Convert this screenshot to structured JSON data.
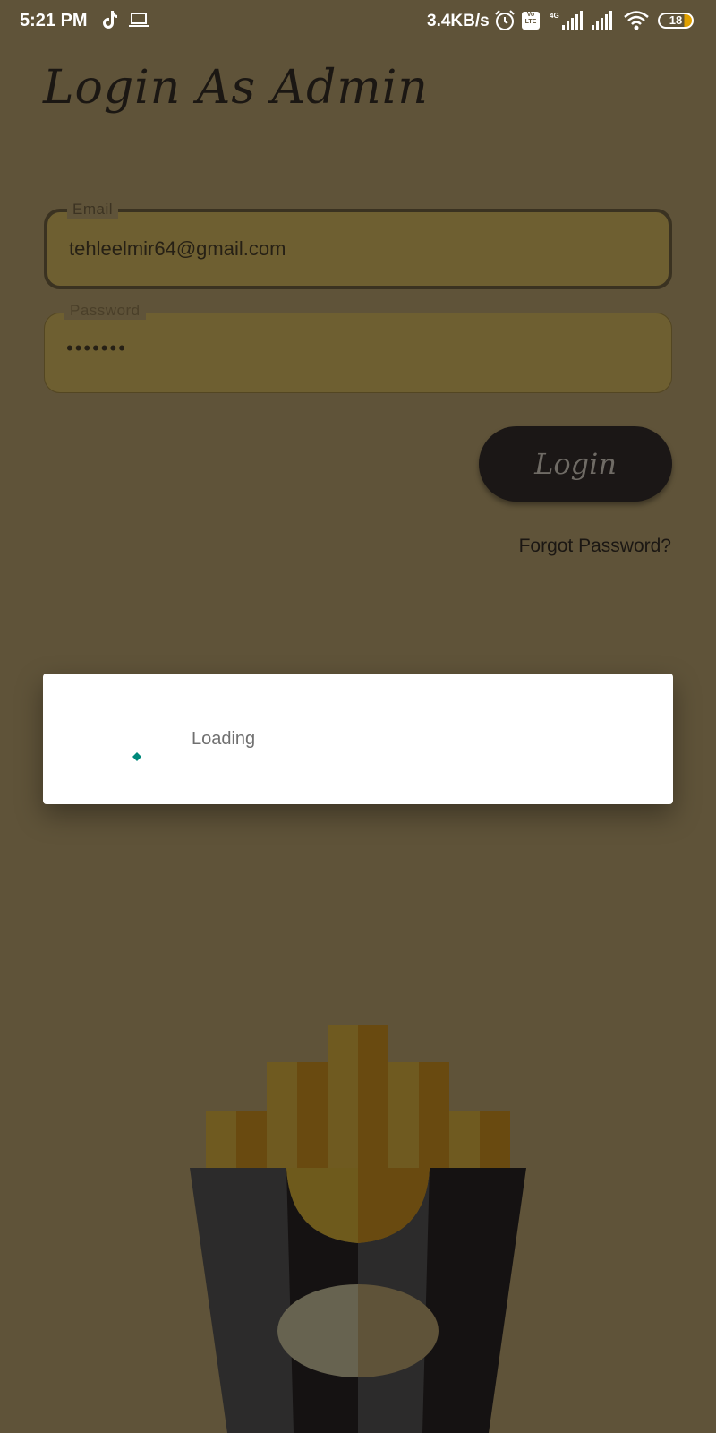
{
  "status_bar": {
    "time": "5:21 PM",
    "network_speed": "3.4KB/s",
    "volte_label": "Vo LTE",
    "network_type": "4G",
    "battery_level": "18",
    "icons": [
      "tiktok-icon",
      "laptop-icon",
      "alarm-icon",
      "volte-icon",
      "signal-icon",
      "signal-icon",
      "wifi-icon",
      "battery-icon"
    ]
  },
  "page": {
    "title": "Login As Admin"
  },
  "form": {
    "email": {
      "label": "Email",
      "value": "tehleelmir64@gmail.com"
    },
    "password": {
      "label": "Password",
      "value": "•••••••"
    },
    "login_button": "Login",
    "forgot_password": "Forgot Password?"
  },
  "loading_dialog": {
    "text": "Loading",
    "spinner_color": "#00897b"
  },
  "colors": {
    "background": "#5f5339",
    "field_fill": "#6e5f31",
    "button": "#1b1716"
  }
}
